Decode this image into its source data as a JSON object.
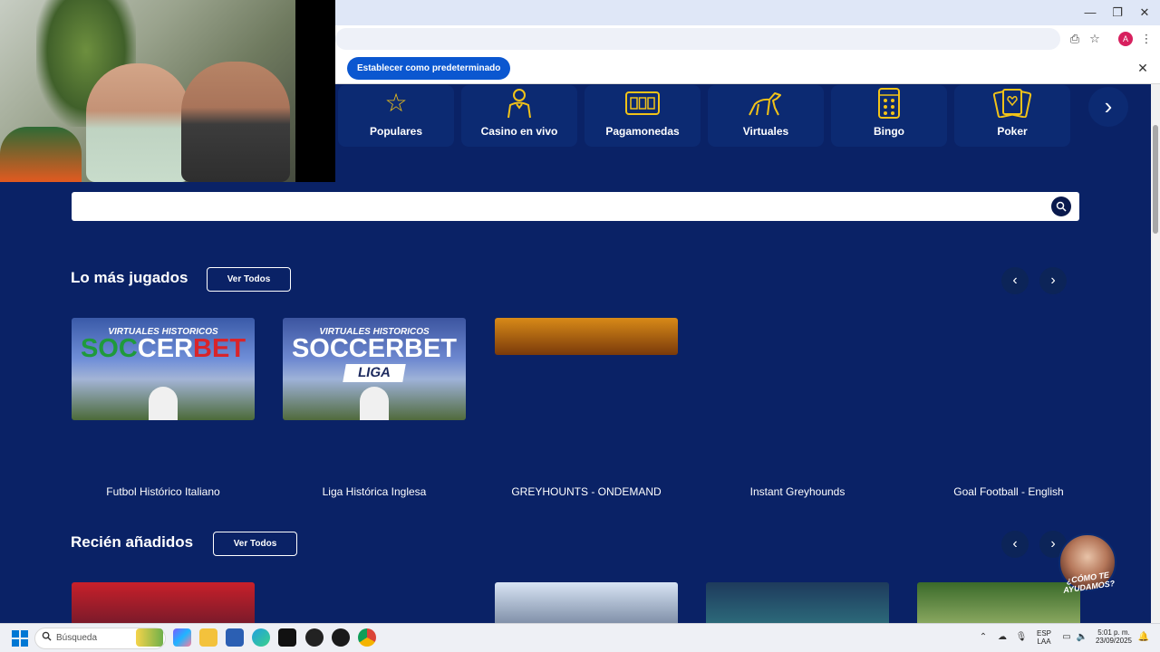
{
  "browser": {
    "infobar_button": "Establecer como predeterminado",
    "profile_initial": "A"
  },
  "categories": [
    {
      "label": "Populares",
      "icon": "star-icon"
    },
    {
      "label": "Casino en vivo",
      "icon": "dealer-icon"
    },
    {
      "label": "Pagamonedas",
      "icon": "slot-machine-icon"
    },
    {
      "label": "Virtuales",
      "icon": "greyhound-icon"
    },
    {
      "label": "Bingo",
      "icon": "bingo-card-icon"
    },
    {
      "label": "Poker",
      "icon": "poker-cards-icon"
    }
  ],
  "search": {
    "placeholder": ""
  },
  "most_played": {
    "title": "Lo más jugados",
    "see_all": "Ver Todos",
    "thumb1": {
      "subtitle": "VIRTUALES HISTORICOS",
      "logo_a": "SOC",
      "logo_b": "CER",
      "logo_c": "BET"
    },
    "thumb2": {
      "subtitle": "VIRTUALES HISTORICOS",
      "logo": "SOCCERBET",
      "badge": "LIGA"
    },
    "games": [
      "Futbol Histórico Italiano",
      "Liga Histórica Inglesa",
      "GREYHOUNTS - ONDEMAND",
      "Instant Greyhounds",
      "Goal Football - English"
    ]
  },
  "recently_added": {
    "title": "Recién añadidos",
    "see_all": "Ver Todos"
  },
  "help": {
    "label": "¿CÓMO TE AYUDAMOS?"
  },
  "taskbar": {
    "search_label": "Búsqueda",
    "lang_top": "ESP",
    "lang_bottom": "LAA",
    "time": "5:01 p. m.",
    "date": "23/09/2025"
  },
  "colors": {
    "page_bg": "#0a2266",
    "accent": "#f2c318",
    "chrome_button": "#0b57d0"
  }
}
